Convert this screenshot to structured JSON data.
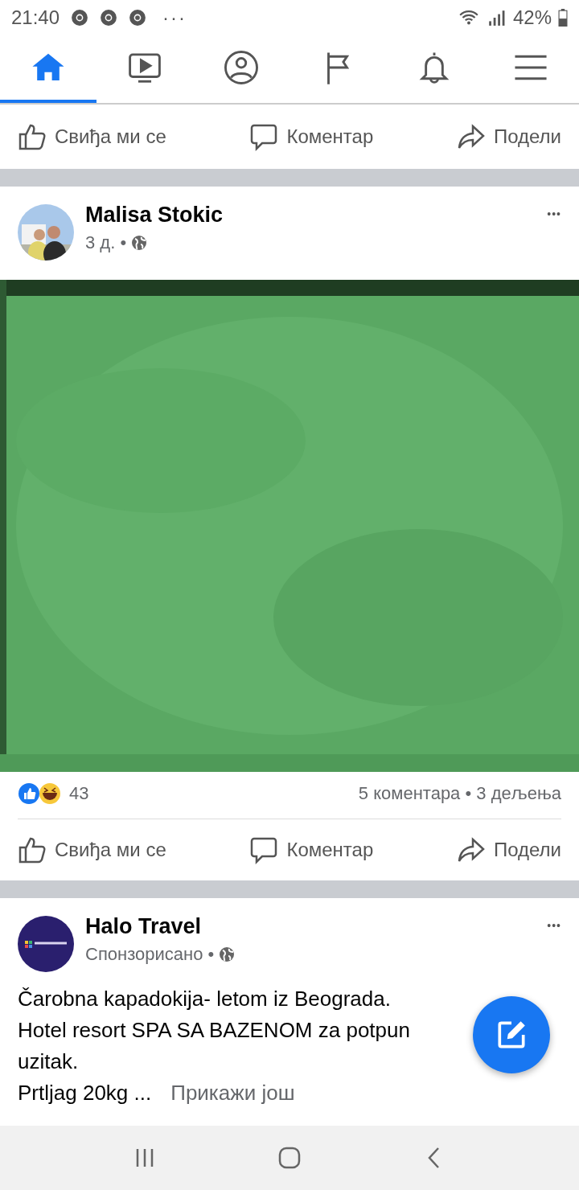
{
  "status_bar": {
    "time": "21:40",
    "more": "···",
    "battery": "42%"
  },
  "nav_tabs": [
    {
      "selected": true
    },
    {
      "selected": false
    },
    {
      "selected": false
    },
    {
      "selected": false
    },
    {
      "selected": false
    },
    {
      "selected": false
    }
  ],
  "previous_post": {
    "actions": [
      "Свиђа ми се",
      "Коментар",
      "Подели"
    ]
  },
  "posts": [
    {
      "author": "Malisa Stokic",
      "meta": "3 д. •",
      "more": "•••",
      "image": {
        "kind": "picture"
      },
      "reactions_count": "43",
      "stats": "5 коментара • 3 дељења",
      "actions": [
        "Свиђа ми се",
        "Коментар",
        "Подели"
      ]
    },
    {
      "author": "Halo Travel",
      "meta": "Спонзорисано •",
      "more": "•••",
      "text_lines": [
        "Čarobna kapadokija- letom iz Beograda.",
        "Hotel resort SPA SA BAZENOM za potpun",
        "uzitak.",
        "Prtljag 20kg ..."
      ],
      "see_more": "Прикажи још"
    }
  ]
}
